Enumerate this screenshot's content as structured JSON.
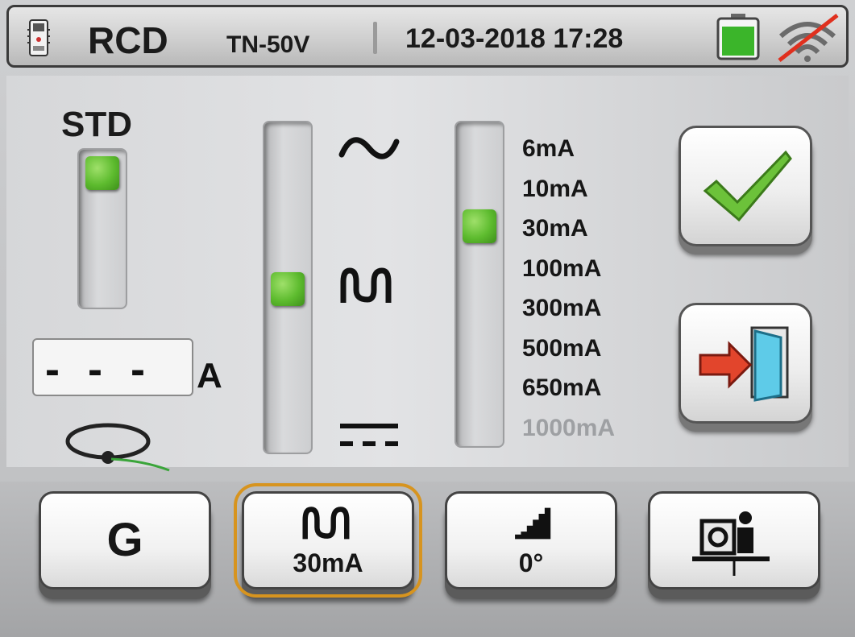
{
  "header": {
    "title": "RCD",
    "mode": "TN-50V",
    "datetime": "12-03-2018 17:28",
    "battery_color": "#3bb52a",
    "wifi_disabled_color": "#e0301e"
  },
  "main": {
    "mode_label": "STD",
    "mode_slider_level": 1.0,
    "waveform_slider_level": 0.5,
    "waveforms": [
      "sine-wave-icon",
      "pulse-wave-icon",
      "dc-wave-icon"
    ],
    "current_slider_level": 0.714,
    "current_options": [
      {
        "label": "6mA",
        "enabled": true
      },
      {
        "label": "10mA",
        "enabled": true
      },
      {
        "label": "30mA",
        "enabled": true
      },
      {
        "label": "100mA",
        "enabled": true
      },
      {
        "label": "300mA",
        "enabled": true
      },
      {
        "label": "500mA",
        "enabled": true
      },
      {
        "label": "650mA",
        "enabled": true
      },
      {
        "label": "1000mA",
        "enabled": false
      }
    ],
    "current_selected": "30mA",
    "measurement_value": "- - -",
    "measurement_unit": "A",
    "confirm_icon": "checkmark-icon",
    "exit_icon": "exit-door-icon",
    "accent_green": "#6cc23a"
  },
  "tabs": [
    {
      "label": "G",
      "sub": ""
    },
    {
      "label": "pulse-wave-icon",
      "sub": "30mA",
      "selected": true
    },
    {
      "label": "ramp-icon",
      "sub": "0°"
    },
    {
      "label": "plug-person-icon",
      "sub": ""
    }
  ],
  "selection_color": "#d7941f"
}
